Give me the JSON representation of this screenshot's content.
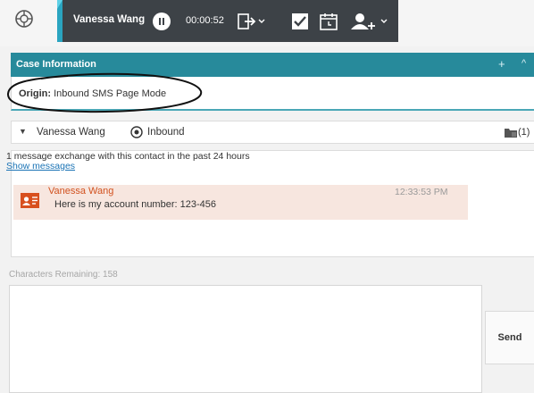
{
  "toolbar": {
    "agent_name": "Vanessa Wang",
    "timer": "00:00:52",
    "icons": [
      "globe-icon",
      "pause-icon",
      "transfer-icon",
      "done-check-icon",
      "schedule-icon",
      "consult-agent-icon"
    ],
    "accent_color": "#2aa4c0",
    "bar_color": "#3d4247"
  },
  "case_info": {
    "title": "Case Information",
    "plus_label": "+",
    "collapse_label": "^",
    "origin_label": "Origin:",
    "origin_value": "Inbound SMS Page Mode",
    "header_color": "#278a9b"
  },
  "contact": {
    "caret": "▼",
    "name": "Vanessa Wang",
    "direction": "Inbound",
    "attachment_count": "(1)"
  },
  "transcript": {
    "info": "1 message exchange with this contact in the past 24 hours",
    "show_messages": "Show messages",
    "messages": [
      {
        "sender": "Vanessa Wang",
        "time": "12:33:53 PM",
        "text": "Here is my account number: 123-456"
      }
    ]
  },
  "composer": {
    "characters_remaining": "Characters Remaining: 158",
    "value": "",
    "send_label": "Send"
  }
}
